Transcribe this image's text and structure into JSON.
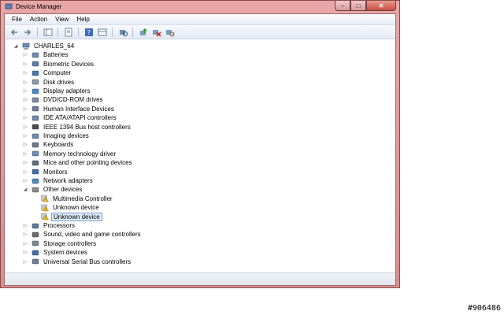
{
  "window": {
    "title": "Device Manager",
    "controls": {
      "minimize": "–",
      "maximize": "□",
      "close": "✕"
    }
  },
  "menu": [
    "File",
    "Action",
    "View",
    "Help"
  ],
  "toolbar": [
    "back-icon",
    "forward-icon",
    "show-hide-tree-icon",
    "properties-icon",
    "help-icon",
    "view-icon",
    "scan-hardware-icon",
    "update-driver-icon",
    "uninstall-icon",
    "disable-icon"
  ],
  "tree": {
    "root": "CHARLES_64",
    "categories": [
      "Batteries",
      "Biometric Devices",
      "Computer",
      "Disk drives",
      "Display adapters",
      "DVD/CD-ROM drives",
      "Human Interface Devices",
      "IDE ATA/ATAPI controllers",
      "IEEE 1394 Bus host controllers",
      "Imaging devices",
      "Keyboards",
      "Memory technology driver",
      "Mice and other pointing devices",
      "Monitors",
      "Network adapters",
      "Other devices",
      "Processors",
      "Sound, video and game controllers",
      "Storage controllers",
      "System devices",
      "Universal Serial Bus controllers"
    ],
    "other_devices": [
      "Multimedia Controller",
      "Unknown device",
      "Unknown device"
    ]
  },
  "watermark": "#906486"
}
